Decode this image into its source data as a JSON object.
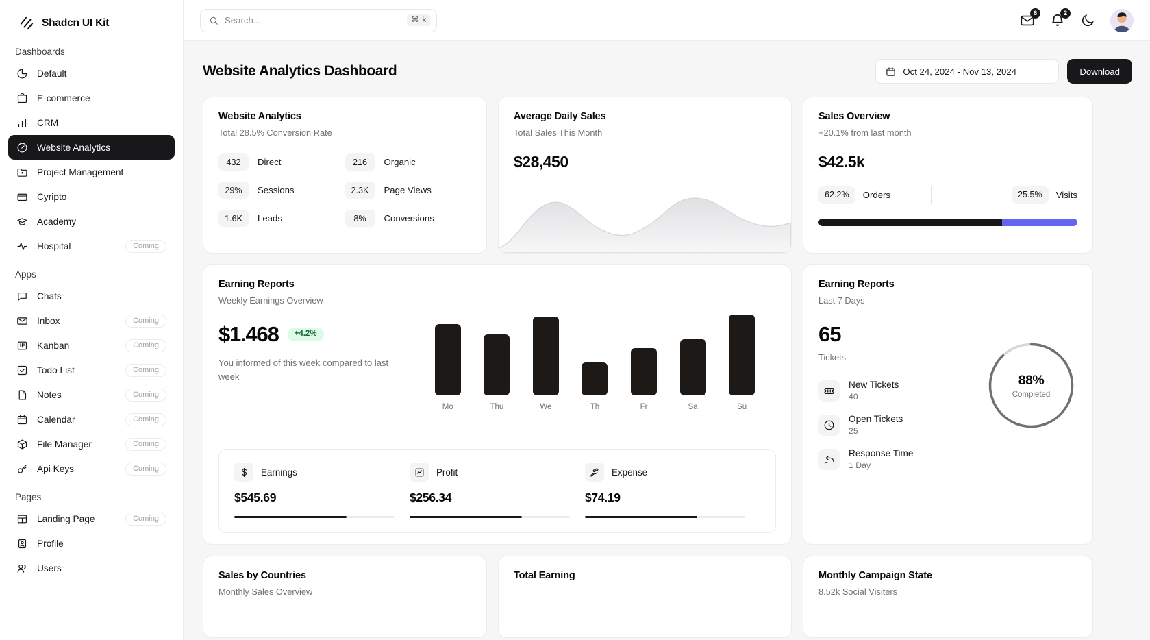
{
  "brand": {
    "name": "Shadcn UI Kit"
  },
  "sidebar": {
    "sections": [
      {
        "label": "Dashboards",
        "items": [
          {
            "label": "Default",
            "icon": "pie-chart-icon",
            "badge": "",
            "active": false
          },
          {
            "label": "E-commerce",
            "icon": "shopping-bag-icon",
            "badge": "",
            "active": false
          },
          {
            "label": "CRM",
            "icon": "bar-chart-icon",
            "badge": "",
            "active": false
          },
          {
            "label": "Website Analytics",
            "icon": "gauge-icon",
            "badge": "",
            "active": true
          },
          {
            "label": "Project Management",
            "icon": "folder-icon",
            "badge": "",
            "active": false
          },
          {
            "label": "Cyripto",
            "icon": "wallet-icon",
            "badge": "",
            "active": false
          },
          {
            "label": "Academy",
            "icon": "graduation-cap-icon",
            "badge": "",
            "active": false
          },
          {
            "label": "Hospital",
            "icon": "activity-icon",
            "badge": "Coming",
            "active": false
          }
        ]
      },
      {
        "label": "Apps",
        "items": [
          {
            "label": "Chats",
            "icon": "message-square-icon",
            "badge": "",
            "active": false
          },
          {
            "label": "Inbox",
            "icon": "mail-icon",
            "badge": "Coming",
            "active": false
          },
          {
            "label": "Kanban",
            "icon": "kanban-icon",
            "badge": "Coming",
            "active": false
          },
          {
            "label": "Todo List",
            "icon": "check-square-icon",
            "badge": "Coming",
            "active": false
          },
          {
            "label": "Notes",
            "icon": "file-icon",
            "badge": "Coming",
            "active": false
          },
          {
            "label": "Calendar",
            "icon": "calendar-icon",
            "badge": "Coming",
            "active": false
          },
          {
            "label": "File Manager",
            "icon": "package-icon",
            "badge": "Coming",
            "active": false
          },
          {
            "label": "Api Keys",
            "icon": "key-icon",
            "badge": "Coming",
            "active": false
          }
        ]
      },
      {
        "label": "Pages",
        "items": [
          {
            "label": "Landing Page",
            "icon": "layout-icon",
            "badge": "Coming",
            "active": false
          },
          {
            "label": "Profile",
            "icon": "id-card-icon",
            "badge": "",
            "active": false
          },
          {
            "label": "Users",
            "icon": "users-icon",
            "badge": "",
            "active": false
          }
        ]
      }
    ]
  },
  "topbar": {
    "search": {
      "value": "",
      "placeholder": "Search...",
      "shortcut": "⌘ k"
    },
    "mail_count": "6",
    "bell_count": "2",
    "theme_icon": "moon-icon"
  },
  "page": {
    "title": "Website Analytics Dashboard",
    "date_range": "Oct 24, 2024 - Nov 13, 2024",
    "download_label": "Download"
  },
  "website_analytics": {
    "title": "Website Analytics",
    "subtitle": "Total 28.5% Conversion Rate",
    "stats": [
      {
        "value": "432",
        "label": "Direct"
      },
      {
        "value": "216",
        "label": "Organic"
      },
      {
        "value": "29%",
        "label": "Sessions"
      },
      {
        "value": "2.3K",
        "label": "Page Views"
      },
      {
        "value": "1.6K",
        "label": "Leads"
      },
      {
        "value": "8%",
        "label": "Conversions"
      }
    ]
  },
  "average_daily_sales": {
    "title": "Average Daily Sales",
    "subtitle": "Total Sales This Month",
    "value": "$28,450"
  },
  "sales_overview": {
    "title": "Sales Overview",
    "subtitle": "+20.1% from last month",
    "value": "$42.5k",
    "orders_pct": "62.2%",
    "orders_label": "Orders",
    "visits_pct": "25.5%",
    "visits_label": "Visits",
    "bar_orders_color": "#18181b",
    "bar_visits_color": "#6366f1"
  },
  "earning_reports": {
    "title": "Earning Reports",
    "subtitle": "Weekly Earnings Overview",
    "amount": "$1.468",
    "change": "+4.2%",
    "note": "You informed of this week compared to last week",
    "footer": [
      {
        "icon": "dollar-icon",
        "name": "Earnings",
        "value": "$545.69",
        "progress": 70
      },
      {
        "icon": "chart-icon",
        "name": "Profit",
        "value": "$256.34",
        "progress": 70
      },
      {
        "icon": "hand-coins-icon",
        "name": "Expense",
        "value": "$74.19",
        "progress": 70
      }
    ]
  },
  "tickets": {
    "title": "Earning Reports",
    "subtitle": "Last 7 Days",
    "count": "65",
    "count_label": "Tickets",
    "rows": [
      {
        "icon": "ticket-icon",
        "name": "New Tickets",
        "value": "40"
      },
      {
        "icon": "clock-icon",
        "name": "Open Tickets",
        "value": "25"
      },
      {
        "icon": "reply-icon",
        "name": "Response Time",
        "value": "1 Day"
      }
    ],
    "donut_pct": "88%",
    "donut_label": "Completed",
    "donut_value": 88
  },
  "bottom_cards": [
    {
      "title": "Sales by Countries",
      "subtitle": "Monthly Sales Overview"
    },
    {
      "title": "Total Earning",
      "subtitle": ""
    },
    {
      "title": "Monthly Campaign State",
      "subtitle": "8.52k Social Visiters"
    }
  ],
  "chart_data": [
    {
      "type": "bar",
      "title": "Earning Reports",
      "subtitle": "Weekly Earnings Overview",
      "categories": [
        "Mo",
        "Thu",
        "We",
        "Th",
        "Fr",
        "Sa",
        "Su"
      ],
      "values": [
        100,
        85,
        110,
        46,
        66,
        79,
        113
      ],
      "ylim": [
        0,
        120
      ],
      "xlabel": "",
      "ylabel": "",
      "grid": false,
      "legend": "none",
      "color": "#1c1917"
    },
    {
      "type": "area",
      "title": "Average Daily Sales",
      "subtitle": "Total Sales This Month",
      "x": [
        0,
        1,
        2,
        3,
        4,
        5,
        6,
        7,
        8
      ],
      "values": [
        10,
        46,
        74,
        62,
        36,
        30,
        46,
        70,
        62
      ],
      "ylim": [
        0,
        100
      ],
      "grid": false,
      "legend": "none",
      "color": "#e4e4e7"
    },
    {
      "type": "pie",
      "title": "Completed",
      "labels": [
        "Completed",
        "Remaining"
      ],
      "values": [
        88,
        12
      ],
      "annotation": "88%",
      "legend": "none",
      "colors": [
        "#71717a",
        "#d4d4d8"
      ]
    }
  ]
}
